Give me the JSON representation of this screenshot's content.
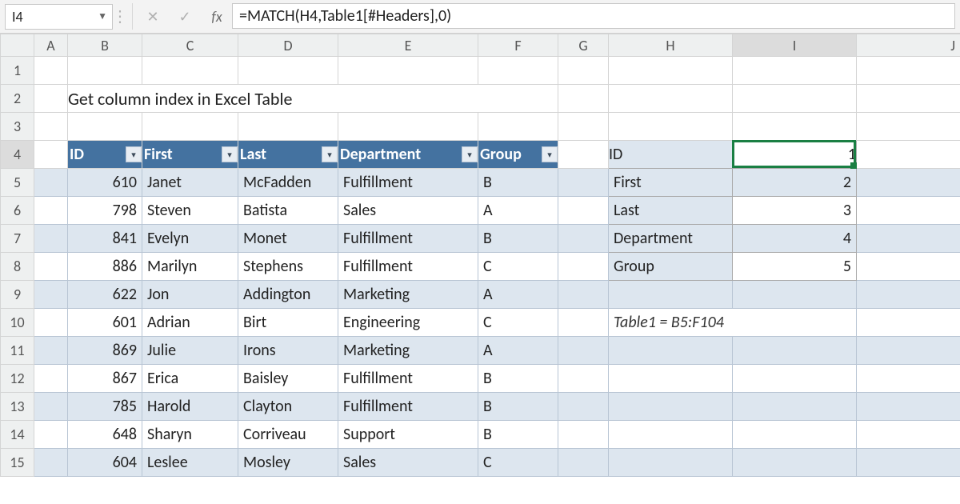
{
  "formula_bar": {
    "cell_ref": "I4",
    "fx_label": "fx",
    "formula": "=MATCH(H4,Table1[#Headers],0)"
  },
  "columns": [
    "A",
    "B",
    "C",
    "D",
    "E",
    "F",
    "G",
    "H",
    "I",
    "J"
  ],
  "row_numbers": [
    "1",
    "2",
    "3",
    "4",
    "5",
    "6",
    "7",
    "8",
    "9",
    "10",
    "11",
    "12",
    "13",
    "14",
    "15"
  ],
  "title": "Get column index in Excel Table",
  "selected_cell": "I4",
  "table1": {
    "headers": {
      "b": "ID",
      "c": "First",
      "d": "Last",
      "e": "Department",
      "f": "Group"
    },
    "rows": [
      {
        "id": "610",
        "first": "Janet",
        "last": "McFadden",
        "dept": "Fulfillment",
        "grp": "B"
      },
      {
        "id": "798",
        "first": "Steven",
        "last": "Batista",
        "dept": "Sales",
        "grp": "A"
      },
      {
        "id": "841",
        "first": "Evelyn",
        "last": "Monet",
        "dept": "Fulfillment",
        "grp": "B"
      },
      {
        "id": "886",
        "first": "Marilyn",
        "last": "Stephens",
        "dept": "Fulfillment",
        "grp": "C"
      },
      {
        "id": "622",
        "first": "Jon",
        "last": "Addington",
        "dept": "Marketing",
        "grp": "A"
      },
      {
        "id": "601",
        "first": "Adrian",
        "last": "Birt",
        "dept": "Engineering",
        "grp": "C"
      },
      {
        "id": "869",
        "first": "Julie",
        "last": "Irons",
        "dept": "Marketing",
        "grp": "A"
      },
      {
        "id": "867",
        "first": "Erica",
        "last": "Baisley",
        "dept": "Fulfillment",
        "grp": "B"
      },
      {
        "id": "785",
        "first": "Harold",
        "last": "Clayton",
        "dept": "Fulfillment",
        "grp": "B"
      },
      {
        "id": "648",
        "first": "Sharyn",
        "last": "Corriveau",
        "dept": "Support",
        "grp": "B"
      },
      {
        "id": "604",
        "first": "Leslee",
        "last": "Mosley",
        "dept": "Sales",
        "grp": "C"
      }
    ]
  },
  "lookup": {
    "rows": [
      {
        "label": "ID",
        "value": "1"
      },
      {
        "label": "First",
        "value": "2"
      },
      {
        "label": "Last",
        "value": "3"
      },
      {
        "label": "Department",
        "value": "4"
      },
      {
        "label": "Group",
        "value": "5"
      }
    ]
  },
  "note": "Table1 = B5:F104",
  "chart_data": {
    "type": "table",
    "title": "Get column index in Excel Table",
    "formula": "=MATCH(H4,Table1[#Headers],0)",
    "table1_headers": [
      "ID",
      "First",
      "Last",
      "Department",
      "Group"
    ],
    "table1_rows": [
      [
        610,
        "Janet",
        "McFadden",
        "Fulfillment",
        "B"
      ],
      [
        798,
        "Steven",
        "Batista",
        "Sales",
        "A"
      ],
      [
        841,
        "Evelyn",
        "Monet",
        "Fulfillment",
        "B"
      ],
      [
        886,
        "Marilyn",
        "Stephens",
        "Fulfillment",
        "C"
      ],
      [
        622,
        "Jon",
        "Addington",
        "Marketing",
        "A"
      ],
      [
        601,
        "Adrian",
        "Birt",
        "Engineering",
        "C"
      ],
      [
        869,
        "Julie",
        "Irons",
        "Marketing",
        "A"
      ],
      [
        867,
        "Erica",
        "Baisley",
        "Fulfillment",
        "B"
      ],
      [
        785,
        "Harold",
        "Clayton",
        "Fulfillment",
        "B"
      ],
      [
        648,
        "Sharyn",
        "Corriveau",
        "Support",
        "B"
      ],
      [
        604,
        "Leslee",
        "Mosley",
        "Sales",
        "C"
      ]
    ],
    "column_index_lookup": {
      "ID": 1,
      "First": 2,
      "Last": 3,
      "Department": 4,
      "Group": 5
    },
    "table1_range": "B5:F104"
  }
}
